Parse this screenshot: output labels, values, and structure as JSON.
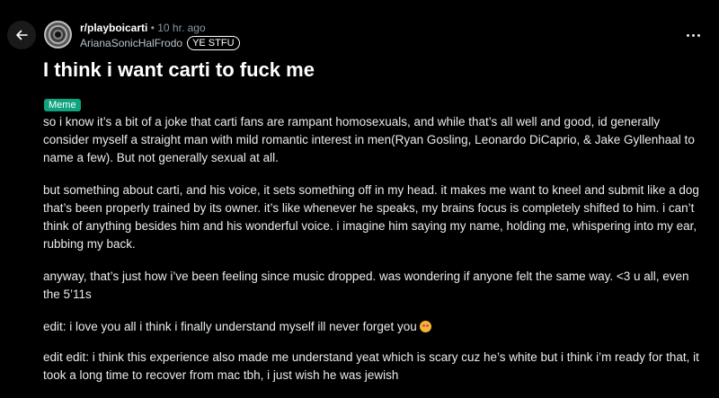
{
  "header": {
    "subreddit": "r/playboicarti",
    "separator": "•",
    "time": "10 hr. ago",
    "username": "ArianaSonicHalFrodo",
    "user_flair": "YE STFU"
  },
  "post": {
    "title": "I think i want carti to fuck me",
    "flair": "Meme",
    "flair_color": "#0fa37f",
    "paragraphs": [
      "so i know it’s a bit of a joke that carti fans are rampant homosexuals, and while that’s all well and good, id generally consider myself a straight man with mild romantic interest in men(Ryan Gosling, Leonardo DiCaprio, & Jake Gyllenhaal to name a few). But not generally sexual at all.",
      "but something about carti, and his voice, it sets something off in my head. it makes me want to kneel and submit like a dog that’s been properly trained by its owner. it’s like whenever he speaks, my brains focus is completely shifted to him. i can’t think of anything besides him and his wonderful voice. i imagine him saying my name, holding me, whispering into my ear, rubbing my back.",
      "anyway, that’s just how i’ve been feeling since music dropped. was wondering if anyone felt the same way. <3 u all, even the 5’11s",
      "edit: i love you all i think i finally understand myself ill never forget you",
      "edit edit: i think this experience also made me understand yeat which is scary cuz he’s white but i think i’m ready for that, it took a long time to recover from mac tbh, i just wish he was jewish"
    ],
    "edit_emoji": "smiling-face-with-tears-icon"
  },
  "icons": {
    "back": "back-arrow-icon",
    "more": "more-options-icon",
    "avatar": "subreddit-avatar"
  }
}
